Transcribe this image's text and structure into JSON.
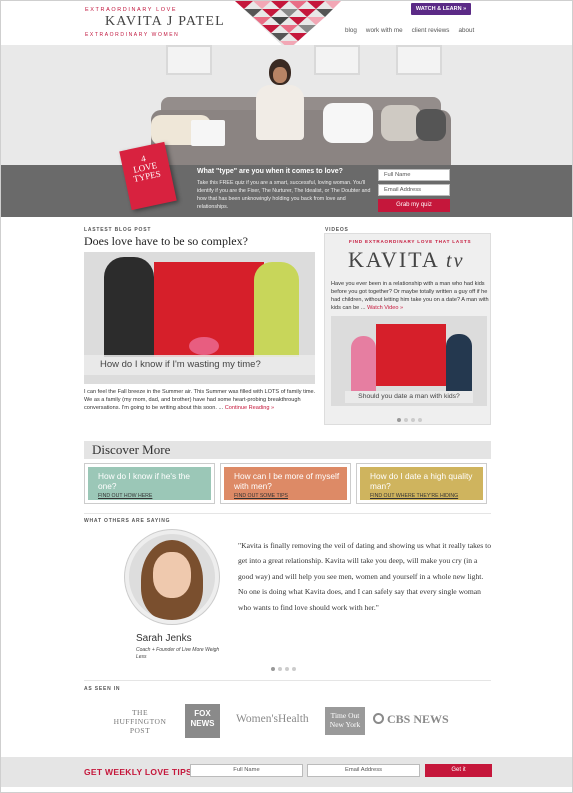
{
  "header": {
    "tagline_top": "EXTRAORDINARY LOVE",
    "brand": "KAVITA J PATEL",
    "tagline_bottom": "EXTRAORDINARY WOMEN",
    "watch_button": "WATCH & LEARN »",
    "nav": [
      "blog",
      "work with me",
      "client reviews",
      "about"
    ]
  },
  "quiz": {
    "book_title": "4 LOVE TYPES",
    "heading": "What \"type\" are you when it comes to love?",
    "body": "Take this FREE quiz if you are a smart, successful, loving woman. You'll identify if you are the Fixer, The Nurturer, The Idealist, or The Doubter and how that has been unknowingly holding you back from love and relationships.",
    "name_placeholder": "Full Name",
    "email_placeholder": "Email Address",
    "button": "Grab my quiz"
  },
  "blog": {
    "label": "LASTEST BLOG POST",
    "title": "Does love have to be so complex?",
    "image_caption": "How do I know if I'm wasting my time?",
    "excerpt": "I can feel the Fall breeze in the Summer air. This Summer was filled with LOTS of family time. We as a family (my mom, dad, and brother) have had some heart-probing breakthrough conversations. I'm going to be writing about this soon. ...",
    "more_link": "Continue Reading »"
  },
  "videos": {
    "label": "VIDEOS",
    "kicker": "FIND EXTRAORDINARY LOVE THAT LASTS",
    "brand_main": "KAVITA",
    "brand_tv": "tv",
    "text": "Have you ever been in a relationship with a man who had kids before you got together? Or maybe totally written a guy off if he had children, without letting him take you on a date? A man with kids can be ...",
    "link": "Watch Video »",
    "thumb_caption": "Should you date a man with kids?"
  },
  "discover": {
    "title": "Discover More",
    "cards": [
      {
        "title": "How do I know if he's the one?",
        "link": "FIND OUT HOW HERE",
        "color": "#9bc7b7"
      },
      {
        "title": "How can I be more of myself with men?",
        "link": "FIND OUT SOME TIPS",
        "color": "#dd8a66"
      },
      {
        "title": "How do I date a high quality man?",
        "link": "FIND OUT WHERE THEY'RE HIDING",
        "color": "#cfb45e"
      }
    ]
  },
  "testimonial": {
    "label": "WHAT OTHERS ARE SAYING",
    "quote": "\"Kavita is finally removing the veil of dating and showing us what it really takes to get into a great relationship. Kavita will take you deep, will make you cry (in a good way) and will help you see men, women and yourself in a whole new light. No one is doing what Kavita does, and I can safely say that every single woman who wants to find love should work with her.\"",
    "name": "Sarah Jenks",
    "role": "Coach + Founder of Live More Weigh Less"
  },
  "press": {
    "label": "AS SEEN IN",
    "logos": [
      "THE HUFFINGTON POST",
      "FOX NEWS",
      "Women'sHealth",
      "Time Out New York",
      "CBS NEWS"
    ]
  },
  "footer": {
    "title": "GET WEEKLY LOVE TIPS",
    "name_placeholder": "Full Name",
    "email_placeholder": "Email Address",
    "button": "Get it"
  }
}
